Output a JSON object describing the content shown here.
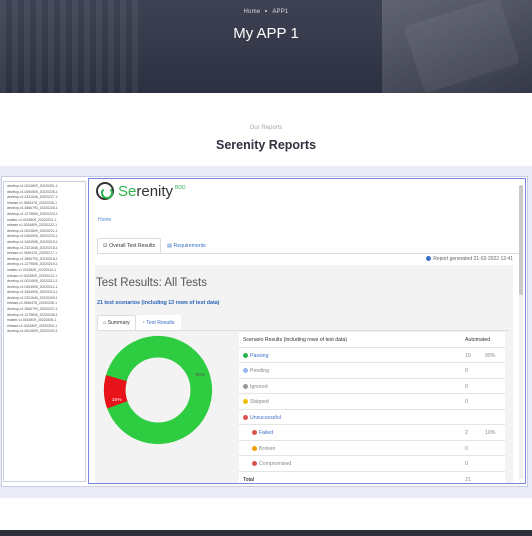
{
  "hero": {
    "breadcrumb": [
      "Home",
      "APP1"
    ],
    "title": "My APP 1"
  },
  "section": {
    "kicker": "Our Reports",
    "title": "Serenity Reports"
  },
  "file_list": [
    "develop-v1.0024809_20220301-1",
    "develop-v1.0454505_20220228-1",
    "develop-v1.2321646_20220227-1",
    "release-v1.3545478_20220226-1",
    "develop-v1.3566793_20220225-1",
    "develop-v1.1279806_20220224-1",
    "master-v1.0024809_20220223-1",
    "release-v1.0024809_20220222-1",
    "develop-v1.0024809_20220221-1",
    "develop-v1.0454505_20220220-1",
    "develop-v1.3454505_20220219-1",
    "develop-v1.2321646_20220218-1",
    "release-v1.3545478_20220217-1",
    "develop-v1.3566793_20220216-1",
    "develop-v1.1279806_20220215-1",
    "master-v1.0024809_20220214-1",
    "release-v1.0024809_20220213-1",
    "develop-v1.0024809_20220212-1",
    "develop-v1.0454505_20220211-1",
    "develop-v1.3454505_20220210-1",
    "develop-v1.2321646_20220209-1",
    "release-v1.3545478_20220208-1",
    "develop-v1.3566793_20220207-1",
    "develop-v1.1279806_20220206-1",
    "master-v1.0024809_20220205-1",
    "release-v1.0024809_20220204-1",
    "develop-v1.0024809_20220203-1"
  ],
  "serenity": {
    "logo_prefix": "Se",
    "logo_rest": "renity",
    "logo_suffix": "BDD",
    "home": "Home",
    "tabs": [
      "Overall Test Results",
      "Requirements"
    ],
    "report_generated": "Report generated 21-02-2022 12:41",
    "results_title": "Test Results: All Tests",
    "scenarios": "21 test scenarios (including 13 rows of test data)",
    "subtabs": [
      "Summary",
      "Test Results"
    ],
    "donut_labels": {
      "passed": "90%",
      "failed": "10%"
    },
    "colors": {
      "passed": "#2ecc40",
      "failed": "#e8131a"
    },
    "table": {
      "headers": [
        "Scenario Results (including rows of test data)",
        "Automated"
      ],
      "rows": [
        {
          "label": "Passing",
          "count": "19",
          "pct": "90%",
          "style": "blue"
        },
        {
          "label": "Pending",
          "count": "0",
          "pct": "",
          "style": "muted"
        },
        {
          "label": "Ignored",
          "count": "0",
          "pct": "",
          "style": "muted"
        },
        {
          "label": "Skipped",
          "count": "0",
          "pct": "",
          "style": "muted"
        },
        {
          "label": "Unsuccessful",
          "count": "",
          "pct": "",
          "style": "blue"
        },
        {
          "label": "Failed",
          "count": "2",
          "pct": "10%",
          "style": "blue"
        },
        {
          "label": "Broken",
          "count": "0",
          "pct": "",
          "style": "muted"
        },
        {
          "label": "Compromised",
          "count": "0",
          "pct": "",
          "style": "muted"
        },
        {
          "label": "Total",
          "count": "21",
          "pct": "",
          "style": "plain"
        }
      ]
    }
  }
}
